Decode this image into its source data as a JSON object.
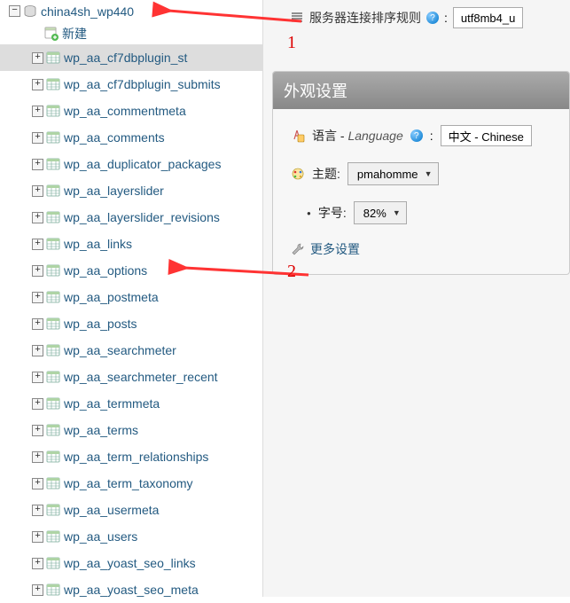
{
  "sidebar": {
    "database": {
      "expander": "−",
      "name": "china4sh_wp440"
    },
    "new_label": "新建",
    "tables": [
      {
        "name": "wp_aa_cf7dbplugin_st",
        "selected": true
      },
      {
        "name": "wp_aa_cf7dbplugin_submits",
        "selected": false
      },
      {
        "name": "wp_aa_commentmeta",
        "selected": false
      },
      {
        "name": "wp_aa_comments",
        "selected": false
      },
      {
        "name": "wp_aa_duplicator_packages",
        "selected": false
      },
      {
        "name": "wp_aa_layerslider",
        "selected": false
      },
      {
        "name": "wp_aa_layerslider_revisions",
        "selected": false
      },
      {
        "name": "wp_aa_links",
        "selected": false
      },
      {
        "name": "wp_aa_options",
        "selected": false
      },
      {
        "name": "wp_aa_postmeta",
        "selected": false
      },
      {
        "name": "wp_aa_posts",
        "selected": false
      },
      {
        "name": "wp_aa_searchmeter",
        "selected": false
      },
      {
        "name": "wp_aa_searchmeter_recent",
        "selected": false
      },
      {
        "name": "wp_aa_termmeta",
        "selected": false
      },
      {
        "name": "wp_aa_terms",
        "selected": false
      },
      {
        "name": "wp_aa_term_relationships",
        "selected": false
      },
      {
        "name": "wp_aa_term_taxonomy",
        "selected": false
      },
      {
        "name": "wp_aa_usermeta",
        "selected": false
      },
      {
        "name": "wp_aa_users",
        "selected": false
      },
      {
        "name": "wp_aa_yoast_seo_links",
        "selected": false
      },
      {
        "name": "wp_aa_yoast_seo_meta",
        "selected": false
      }
    ]
  },
  "top": {
    "collation_label": "服务器连接排序规则",
    "collation_value": "utf8mb4_u"
  },
  "panel": {
    "title": "外观设置",
    "language": {
      "label": "语言 - ",
      "label_en": "Language",
      "value": "中文 - Chinese"
    },
    "theme": {
      "label": "主题:",
      "value": "pmahomme"
    },
    "fontsize": {
      "label": "字号:",
      "value": "82%"
    },
    "more": "更多设置"
  },
  "annotations": {
    "a1": "1",
    "a2": "2"
  }
}
